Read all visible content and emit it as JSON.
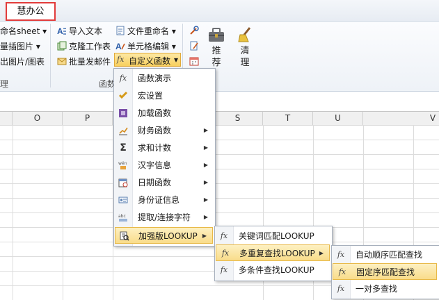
{
  "tab": {
    "active": "慧办公"
  },
  "ribbon": {
    "col1": [
      "命名sheet",
      "量插图片",
      "出图片/图表"
    ],
    "col2": [
      "导入文本",
      "克隆工作表",
      "批量发邮件"
    ],
    "col3": [
      "文件重命名",
      "单元格编辑",
      "自定义函数"
    ],
    "big_buttons": {
      "recommend": "推\n荐",
      "recommend_1": "推",
      "recommend_2": "荐",
      "clean_1": "清",
      "clean_2": "理"
    },
    "group_labels": {
      "left": "理",
      "mid": "函数"
    }
  },
  "columns": [
    "O",
    "P",
    "S",
    "T",
    "U",
    "V"
  ],
  "menu1": {
    "items": [
      {
        "label": "函数演示",
        "icon": "fx-icon",
        "sub": false
      },
      {
        "label": "宏设置",
        "icon": "macro-icon",
        "sub": false
      },
      {
        "label": "加载函数",
        "icon": "load-icon",
        "sub": false
      },
      {
        "label": "财务函数",
        "icon": "finance-icon",
        "sub": true
      },
      {
        "label": "求和计数",
        "icon": "sigma-icon",
        "sub": true
      },
      {
        "label": "汉字信息",
        "icon": "chinese-icon",
        "sub": true
      },
      {
        "label": "日期函数",
        "icon": "calendar-icon",
        "sub": true
      },
      {
        "label": "身份证信息",
        "icon": "id-card-icon",
        "sub": true
      },
      {
        "label": "提取/连接字符",
        "icon": "text-icon",
        "sub": true
      },
      {
        "label": "加强版LOOKUP",
        "icon": "lookup-icon",
        "sub": true
      }
    ]
  },
  "menu2": {
    "items": [
      {
        "label": "关键词匹配LOOKUP",
        "sub": false
      },
      {
        "label": "多重复查找LOOKUP",
        "sub": true
      },
      {
        "label": "多条件查找LOOKUP",
        "sub": false
      }
    ]
  },
  "menu3": {
    "items": [
      {
        "label": "自动顺序匹配查找"
      },
      {
        "label": "固定序匹配查找"
      },
      {
        "label": "一对多查找"
      }
    ]
  },
  "glyphs": {
    "fx": "fx",
    "arrow": "▶",
    "dropdown": "▾",
    "sigma": "Σ"
  }
}
